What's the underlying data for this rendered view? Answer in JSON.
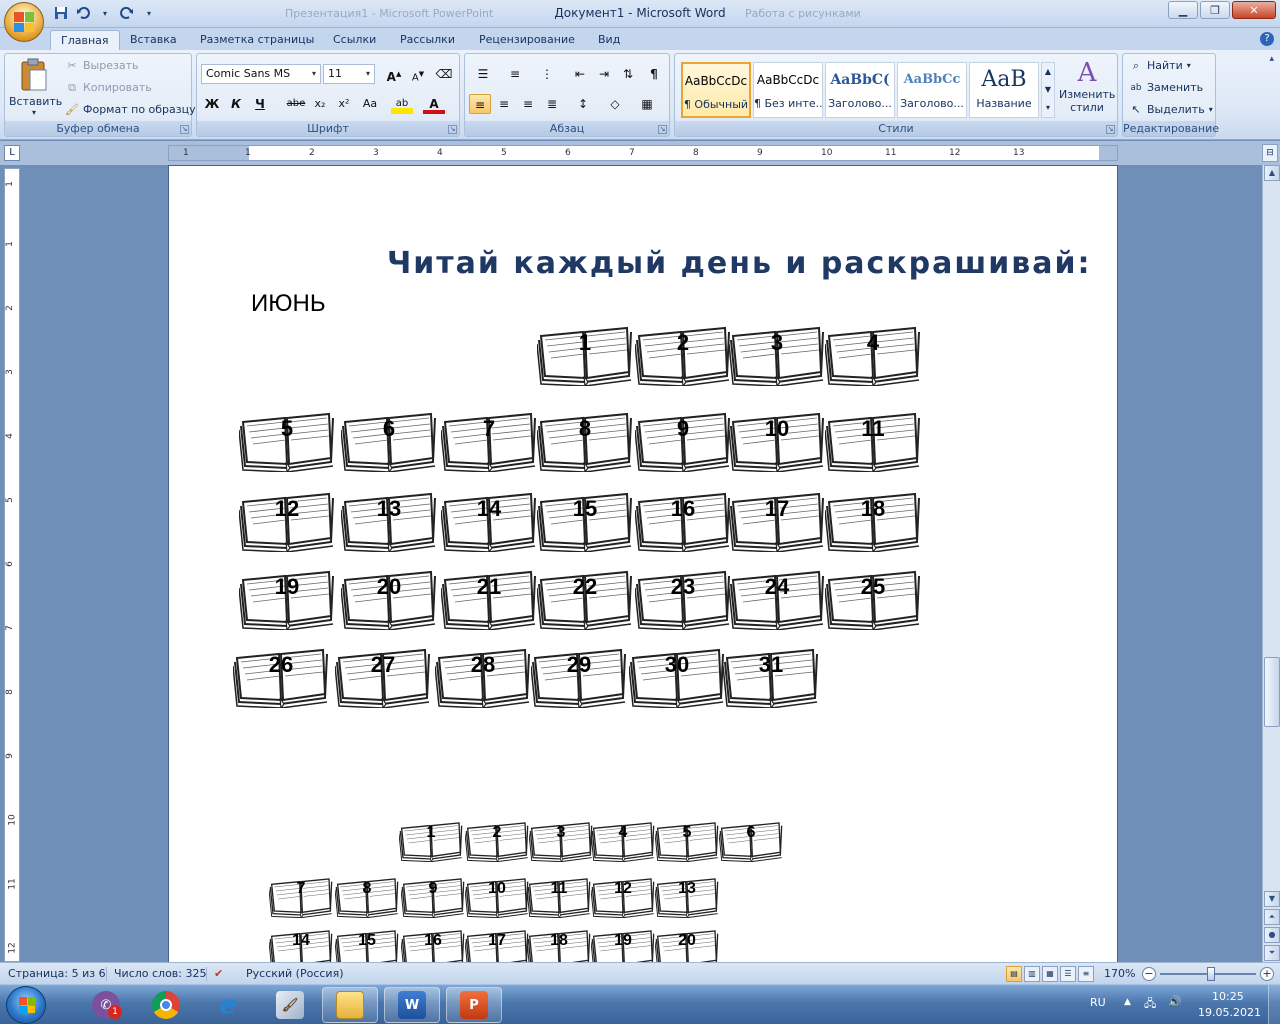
{
  "window": {
    "title": "Документ1 - Microsoft Word",
    "ghost_left": "Презентация1 - Microsoft PowerPoint",
    "ghost_right": "Работа с рисунками"
  },
  "qat": {
    "save_icon": "save-icon",
    "undo_icon": "undo-icon",
    "redo_icon": "redo-icon"
  },
  "tabs": [
    {
      "label": "Главная",
      "active": true
    },
    {
      "label": "Вставка"
    },
    {
      "label": "Разметка страницы"
    },
    {
      "label": "Ссылки"
    },
    {
      "label": "Рассылки"
    },
    {
      "label": "Рецензирование"
    },
    {
      "label": "Вид"
    }
  ],
  "clipboard": {
    "paste": "Вставить",
    "cut": "Вырезать",
    "copy": "Копировать",
    "format_painter": "Формат по образцу",
    "label": "Буфер обмена"
  },
  "font": {
    "name": "Comic Sans MS",
    "size": "11",
    "bold": "Ж",
    "italic": "К",
    "underline": "Ч",
    "strike": "abe",
    "subscript": "x₂",
    "superscript": "x²",
    "case": "Aa",
    "grow": "A",
    "shrink": "A",
    "highlight": "ab",
    "color": "A",
    "label": "Шрифт"
  },
  "paragraph": {
    "label": "Абзац",
    "pilcrow": "¶"
  },
  "styles": {
    "label": "Стили",
    "items": [
      {
        "sample": "AaBbCcDc",
        "name": "¶ Обычный",
        "selected": true
      },
      {
        "sample": "AaBbCcDc",
        "name": "¶ Без инте..."
      },
      {
        "sample": "AaBbC(",
        "name": "Заголово..."
      },
      {
        "sample": "AaBbCc",
        "name": "Заголово..."
      },
      {
        "sample": "AaB",
        "name": "Название"
      }
    ],
    "change": "Изменить стили"
  },
  "editing": {
    "find": "Найти",
    "replace": "Заменить",
    "select": "Выделить",
    "label": "Редактирование"
  },
  "ruler": {
    "h_ticks": [
      "1",
      "1",
      "2",
      "3",
      "4",
      "5",
      "6",
      "7",
      "8",
      "9",
      "10",
      "11",
      "12",
      "13"
    ],
    "v_ticks": [
      "1",
      "1",
      "2",
      "3",
      "4",
      "5",
      "6",
      "7",
      "8",
      "9",
      "10",
      "11",
      "12"
    ]
  },
  "document": {
    "title": "Читай каждый день и раскрашивай:",
    "month": "ИЮНЬ",
    "big_days": [
      "1",
      "2",
      "3",
      "4",
      "5",
      "6",
      "7",
      "8",
      "9",
      "10",
      "11",
      "12",
      "13",
      "14",
      "15",
      "16",
      "17",
      "18",
      "19",
      "20",
      "21",
      "22",
      "23",
      "24",
      "25",
      "26",
      "27",
      "28",
      "29",
      "30",
      "31"
    ],
    "small_days": [
      "1",
      "2",
      "3",
      "4",
      "5",
      "6",
      "7",
      "8",
      "9",
      "10",
      "11",
      "12",
      "13",
      "14",
      "15",
      "16",
      "17",
      "18",
      "19",
      "20"
    ]
  },
  "status": {
    "page": "Страница: 5 из 6",
    "words": "Число слов: 325",
    "language": "Русский (Россия)",
    "zoom": "170%",
    "zoom_level": 0.53
  },
  "taskbar": {
    "apps": [
      {
        "name": "viber",
        "badge": "1"
      },
      {
        "name": "chrome"
      },
      {
        "name": "internet-explorer"
      },
      {
        "name": "paint"
      },
      {
        "name": "explorer"
      },
      {
        "name": "word",
        "glyph": "W"
      },
      {
        "name": "powerpoint",
        "glyph": "P"
      }
    ],
    "lang": "RU",
    "time": "10:25",
    "date": "19.05.2021"
  }
}
